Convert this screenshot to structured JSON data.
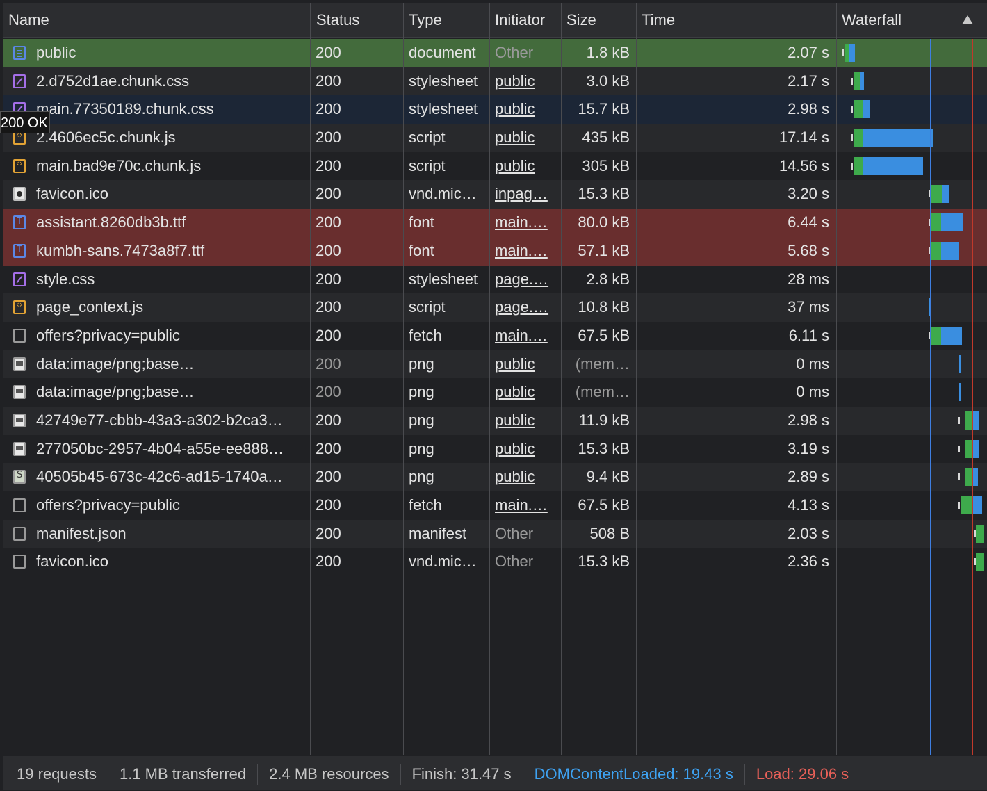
{
  "columns": {
    "name": "Name",
    "status": "Status",
    "type": "Type",
    "initiator": "Initiator",
    "size": "Size",
    "time": "Time",
    "waterfall": "Waterfall"
  },
  "tooltip": "200 OK",
  "colors": {
    "waiting": "#3eaa4c",
    "download": "#3a8ee0",
    "dom_content_loaded": "#3e7ee0",
    "load": "#c0392b",
    "selected_row": "#436b3c",
    "error_row": "#692e2e"
  },
  "rows": [
    {
      "name": "public",
      "icon": "document-icon",
      "status": "200",
      "type": "document",
      "initiator": "Other",
      "initiator_link": false,
      "size": "1.8 kB",
      "time": "2.07 s",
      "row_state": "selected"
    },
    {
      "name": "2.d752d1ae.chunk.css",
      "icon": "stylesheet-icon",
      "status": "200",
      "type": "stylesheet",
      "initiator": "public",
      "initiator_link": true,
      "size": "3.0 kB",
      "time": "2.17 s",
      "row_state": "normal"
    },
    {
      "name": "main.77350189.chunk.css",
      "icon": "stylesheet-icon",
      "status": "200",
      "type": "stylesheet",
      "initiator": "public",
      "initiator_link": true,
      "size": "15.7 kB",
      "time": "2.98 s",
      "row_state": "hover"
    },
    {
      "name": "2.4606ec5c.chunk.js",
      "icon": "script-icon",
      "status": "200",
      "type": "script",
      "initiator": "public",
      "initiator_link": true,
      "size": "435 kB",
      "time": "17.14 s",
      "row_state": "normal"
    },
    {
      "name": "main.bad9e70c.chunk.js",
      "icon": "script-icon",
      "status": "200",
      "type": "script",
      "initiator": "public",
      "initiator_link": true,
      "size": "305 kB",
      "time": "14.56 s",
      "row_state": "normal"
    },
    {
      "name": "favicon.ico",
      "icon": "favicon-icon",
      "status": "200",
      "type": "vnd.mic…",
      "initiator": "inpag…",
      "initiator_link": true,
      "size": "15.3 kB",
      "time": "3.20 s",
      "row_state": "normal"
    },
    {
      "name": "assistant.8260db3b.ttf",
      "icon": "font-icon",
      "status": "200",
      "type": "font",
      "initiator": "main.…",
      "initiator_link": true,
      "size": "80.0 kB",
      "time": "6.44 s",
      "row_state": "error"
    },
    {
      "name": "kumbh-sans.7473a8f7.ttf",
      "icon": "font-icon",
      "status": "200",
      "type": "font",
      "initiator": "main.…",
      "initiator_link": true,
      "size": "57.1 kB",
      "time": "5.68 s",
      "row_state": "error"
    },
    {
      "name": "style.css",
      "icon": "stylesheet-icon",
      "status": "200",
      "type": "stylesheet",
      "initiator": "page.…",
      "initiator_link": true,
      "size": "2.8 kB",
      "time": "28 ms",
      "row_state": "normal"
    },
    {
      "name": "page_context.js",
      "icon": "script-icon",
      "status": "200",
      "type": "script",
      "initiator": "page.…",
      "initiator_link": true,
      "size": "10.8 kB",
      "time": "37 ms",
      "row_state": "normal"
    },
    {
      "name": "offers?privacy=public",
      "icon": "fetch-icon",
      "status": "200",
      "type": "fetch",
      "initiator": "main.…",
      "initiator_link": true,
      "size": "67.5 kB",
      "time": "6.11 s",
      "row_state": "normal"
    },
    {
      "name": "data:image/png;base…",
      "icon": "image-icon",
      "status": "200",
      "status_muted": true,
      "type": "png",
      "initiator": "public",
      "initiator_link": true,
      "size": "(mem…",
      "size_muted": true,
      "time": "0 ms",
      "row_state": "normal"
    },
    {
      "name": "data:image/png;base…",
      "icon": "image-icon",
      "status": "200",
      "status_muted": true,
      "type": "png",
      "initiator": "public",
      "initiator_link": true,
      "size": "(mem…",
      "size_muted": true,
      "time": "0 ms",
      "row_state": "normal"
    },
    {
      "name": "42749e77-cbbb-43a3-a302-b2ca3…",
      "icon": "image-icon",
      "status": "200",
      "type": "png",
      "initiator": "public",
      "initiator_link": true,
      "size": "11.9 kB",
      "time": "2.98 s",
      "row_state": "normal"
    },
    {
      "name": "277050bc-2957-4b04-a55e-ee888…",
      "icon": "image-icon",
      "status": "200",
      "type": "png",
      "initiator": "public",
      "initiator_link": true,
      "size": "15.3 kB",
      "time": "3.19 s",
      "row_state": "normal"
    },
    {
      "name": "40505b45-673c-42c6-ad15-1740a…",
      "icon": "shield-icon",
      "status": "200",
      "type": "png",
      "initiator": "public",
      "initiator_link": true,
      "size": "9.4 kB",
      "time": "2.89 s",
      "row_state": "normal"
    },
    {
      "name": "offers?privacy=public",
      "icon": "fetch-icon",
      "status": "200",
      "type": "fetch",
      "initiator": "main.…",
      "initiator_link": true,
      "size": "67.5 kB",
      "time": "4.13 s",
      "row_state": "normal"
    },
    {
      "name": "manifest.json",
      "icon": "fetch-icon",
      "status": "200",
      "type": "manifest",
      "initiator": "Other",
      "initiator_link": false,
      "size": "508 B",
      "time": "2.03 s",
      "row_state": "normal"
    },
    {
      "name": "favicon.ico",
      "icon": "fetch-icon",
      "status": "200",
      "type": "vnd.mic…",
      "initiator": "Other",
      "initiator_link": false,
      "size": "15.3 kB",
      "time": "2.36 s",
      "row_state": "normal"
    }
  ],
  "footer": {
    "requests": "19 requests",
    "transferred": "1.1 MB transferred",
    "resources": "2.4 MB resources",
    "finish": "Finish: 31.47 s",
    "dom_content_loaded": "DOMContentLoaded: 19.43 s",
    "load": "Load: 29.06 s"
  }
}
